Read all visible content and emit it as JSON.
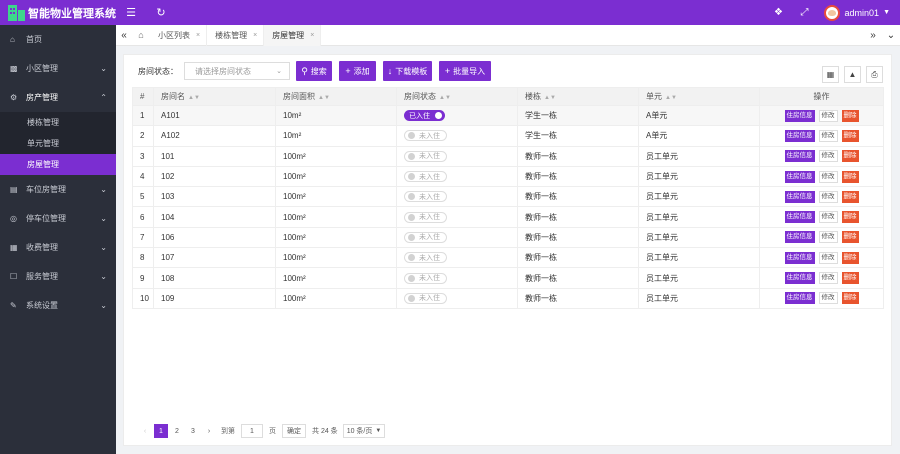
{
  "app": {
    "title": "智能物业管理系统",
    "logo_icon": "building-icon"
  },
  "topbar": {
    "menu_toggle_icon": "hamburger-icon",
    "refresh_icon": "refresh-icon",
    "tag_icon": "tag-icon",
    "fullscreen_icon": "expand-icon",
    "user_name": "admin01"
  },
  "sidebar": {
    "items": [
      {
        "label": "首页",
        "icon": "home-icon"
      },
      {
        "label": "小区管理",
        "icon": "community-icon"
      },
      {
        "label": "房产管理",
        "icon": "house-icon",
        "open": true,
        "children": [
          {
            "label": "楼栋管理"
          },
          {
            "label": "单元管理"
          },
          {
            "label": "房屋管理",
            "active": true
          }
        ]
      },
      {
        "label": "车位房管理",
        "icon": "parking-icon"
      },
      {
        "label": "停车位管理",
        "icon": "car-icon"
      },
      {
        "label": "收费管理",
        "icon": "fee-icon"
      },
      {
        "label": "服务管理",
        "icon": "service-icon"
      },
      {
        "label": "系统设置",
        "icon": "settings-icon"
      }
    ]
  },
  "tabs": [
    {
      "label": "小区列表"
    },
    {
      "label": "楼栋管理"
    },
    {
      "label": "房屋管理",
      "active": true
    }
  ],
  "filter": {
    "label": "房间状态：",
    "placeholder": "请选择房间状态"
  },
  "buttons": {
    "search": "搜索",
    "add": "添加",
    "download_template": "下载模板",
    "batch_import": "批量导入"
  },
  "table": {
    "columns": [
      "#",
      "房间名",
      "房间面积",
      "房间状态",
      "楼栋",
      "单元",
      "操作"
    ],
    "actions": {
      "info": "住房信息",
      "edit": "修改",
      "delete": "删除"
    },
    "rows": [
      {
        "no": "1",
        "name": "A101",
        "area": "10m²",
        "status": "已入住",
        "occupied": true,
        "building": "学生一栋",
        "unit": "A单元"
      },
      {
        "no": "2",
        "name": "A102",
        "area": "10m²",
        "status": "未入住",
        "occupied": false,
        "building": "学生一栋",
        "unit": "A单元"
      },
      {
        "no": "3",
        "name": "101",
        "area": "100m²",
        "status": "未入住",
        "occupied": false,
        "building": "教师一栋",
        "unit": "员工单元"
      },
      {
        "no": "4",
        "name": "102",
        "area": "100m²",
        "status": "未入住",
        "occupied": false,
        "building": "教师一栋",
        "unit": "员工单元"
      },
      {
        "no": "5",
        "name": "103",
        "area": "100m²",
        "status": "未入住",
        "occupied": false,
        "building": "教师一栋",
        "unit": "员工单元"
      },
      {
        "no": "6",
        "name": "104",
        "area": "100m²",
        "status": "未入住",
        "occupied": false,
        "building": "教师一栋",
        "unit": "员工单元"
      },
      {
        "no": "7",
        "name": "106",
        "area": "100m²",
        "status": "未入住",
        "occupied": false,
        "building": "教师一栋",
        "unit": "员工单元"
      },
      {
        "no": "8",
        "name": "107",
        "area": "100m²",
        "status": "未入住",
        "occupied": false,
        "building": "教师一栋",
        "unit": "员工单元"
      },
      {
        "no": "9",
        "name": "108",
        "area": "100m²",
        "status": "未入住",
        "occupied": false,
        "building": "教师一栋",
        "unit": "员工单元"
      },
      {
        "no": "10",
        "name": "109",
        "area": "100m²",
        "status": "未入住",
        "occupied": false,
        "building": "教师一栋",
        "unit": "员工单元"
      }
    ]
  },
  "pagination": {
    "pages": [
      "1",
      "2",
      "3"
    ],
    "current": "1",
    "goto_label": "到第",
    "goto_value": "1",
    "page_unit": "页",
    "confirm": "确定",
    "total": "共 24 条",
    "page_size": "10 条/页"
  },
  "colors": {
    "primary": "#7b2ed1",
    "danger": "#e8542e",
    "sidebar": "#2b2f3a"
  }
}
